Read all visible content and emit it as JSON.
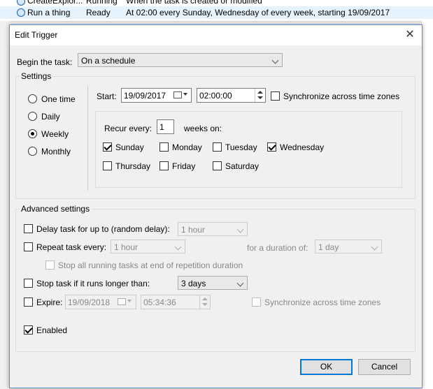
{
  "background": {
    "rows": [
      {
        "name": "CreateExplor...",
        "status": "Running",
        "trigger": "When the task is created or modified"
      },
      {
        "name": "Run a thing",
        "status": "Ready",
        "trigger": "At 02:00 every Sunday, Wednesday of every week, starting 19/09/2017"
      }
    ]
  },
  "dialog": {
    "title": "Edit Trigger",
    "begin_label": "Begin the task:",
    "begin_value": "On a schedule",
    "settings": {
      "group_label": "Settings",
      "radios": [
        {
          "label": "One time",
          "checked": false
        },
        {
          "label": "Daily",
          "checked": false
        },
        {
          "label": "Weekly",
          "checked": true
        },
        {
          "label": "Monthly",
          "checked": false
        }
      ],
      "start_label": "Start:",
      "start_date": "19/09/2017",
      "start_time": "02:00:00",
      "sync_label": "Synchronize across time zones",
      "recur_label": "Recur every:",
      "recur_value": "1",
      "weeks_on_label": "weeks on:",
      "days": [
        {
          "label": "Sunday",
          "checked": true
        },
        {
          "label": "Monday",
          "checked": false
        },
        {
          "label": "Tuesday",
          "checked": false
        },
        {
          "label": "Wednesday",
          "checked": true
        },
        {
          "label": "Thursday",
          "checked": false
        },
        {
          "label": "Friday",
          "checked": false
        },
        {
          "label": "Saturday",
          "checked": false
        }
      ]
    },
    "advanced": {
      "group_label": "Advanced settings",
      "delay_label": "Delay task for up to (random delay):",
      "delay_value": "1 hour",
      "repeat_label": "Repeat task every:",
      "repeat_value": "1 hour",
      "duration_label": "for a duration of:",
      "duration_value": "1 day",
      "stop_all_label": "Stop all running tasks at end of repetition duration",
      "stop_if_label": "Stop task if it runs longer than:",
      "stop_if_value": "3 days",
      "expire_label": "Expire:",
      "expire_date": "19/09/2018",
      "expire_time": "05:34:36",
      "expire_sync_label": "Synchronize across time zones",
      "enabled_label": "Enabled",
      "enabled_checked": true
    },
    "ok_label": "OK",
    "cancel_label": "Cancel"
  }
}
